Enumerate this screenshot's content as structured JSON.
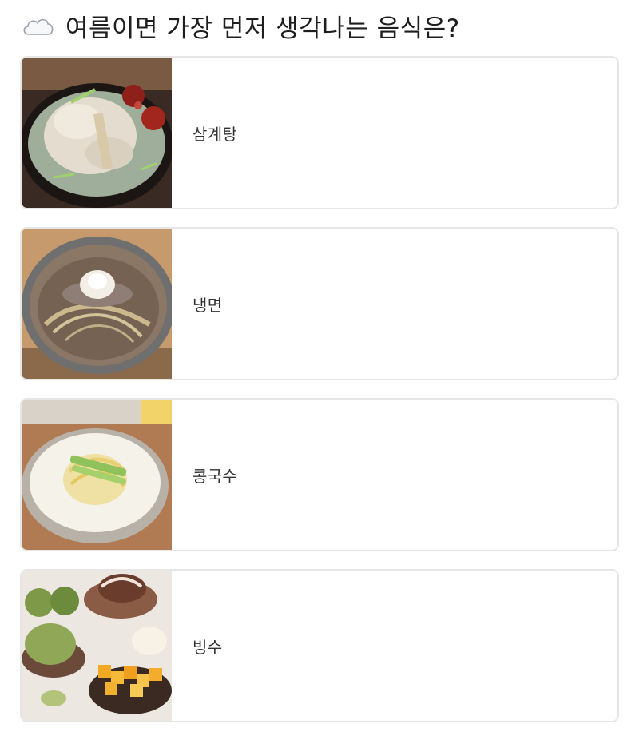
{
  "header": {
    "icon": "cloud-icon",
    "title": "여름이면 가장 먼저 생각나는 음식은?"
  },
  "options": [
    {
      "label": "삼계탕",
      "image": "samgyetang-image"
    },
    {
      "label": "냉면",
      "image": "naengmyeon-image"
    },
    {
      "label": "콩국수",
      "image": "kongguksu-image"
    },
    {
      "label": "빙수",
      "image": "bingsu-image"
    }
  ]
}
